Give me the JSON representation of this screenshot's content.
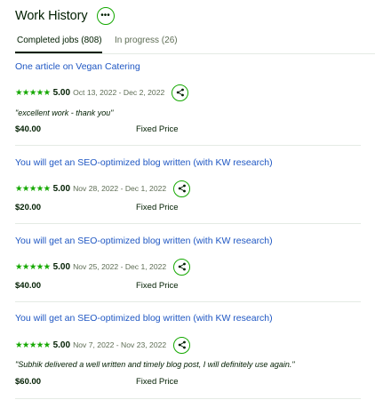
{
  "header": {
    "title": "Work History",
    "more_icon": "more-horizontal-icon"
  },
  "tabs": [
    {
      "label": "Completed jobs (808)",
      "active": true
    },
    {
      "label": "In progress (26)",
      "active": false
    }
  ],
  "colors": {
    "title_link": "#1f57c3",
    "accent_green": "#14a800",
    "text": "#001e00",
    "muted": "#5e6d55"
  },
  "jobs": [
    {
      "title": "One article on Vegan Catering",
      "stars": "★★★★★",
      "rating": "5.00",
      "dates": "Oct 13, 2022 - Dec 2, 2022",
      "feedback": "\"excellent work - thank you\"",
      "price": "$40.00",
      "price_type": "Fixed Price"
    },
    {
      "title": "You will get an SEO-optimized blog written (with KW research)",
      "stars": "★★★★★",
      "rating": "5.00",
      "dates": "Nov 28, 2022 - Dec 1, 2022",
      "feedback": "",
      "price": "$20.00",
      "price_type": "Fixed Price"
    },
    {
      "title": "You will get an SEO-optimized blog written (with KW research)",
      "stars": "★★★★★",
      "rating": "5.00",
      "dates": "Nov 25, 2022 - Dec 1, 2022",
      "feedback": "",
      "price": "$40.00",
      "price_type": "Fixed Price"
    },
    {
      "title": "You will get an SEO-optimized blog written (with KW research)",
      "stars": "★★★★★",
      "rating": "5.00",
      "dates": "Nov 7, 2022 - Nov 23, 2022",
      "feedback": "\"Subhik delivered a well written and timely blog post, I will definitely use again.\"",
      "price": "$60.00",
      "price_type": "Fixed Price"
    }
  ]
}
